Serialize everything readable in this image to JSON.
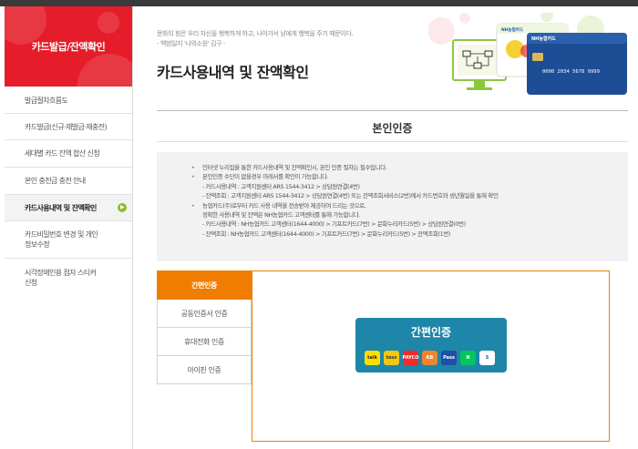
{
  "sidebar": {
    "title": "카드발급/잔액확인",
    "items": [
      {
        "label": "발급절차흐름도"
      },
      {
        "label": "카드발급(신규·재발급·재충전)"
      },
      {
        "label": "세대별 카드 잔액 합산 신청"
      },
      {
        "label": "본인 충전금 충전 안내"
      },
      {
        "label": "카드사용내역 및 잔액확인"
      },
      {
        "label": "카드비밀번호 변경 및 개인",
        "label2": "정보수정"
      },
      {
        "label": "시각장애인용 점자 스티커",
        "label2": "신청"
      }
    ]
  },
  "header": {
    "quote1": "문화의 힘은 우리 자신을 행복하게 하고, 나아가서 남에게 행복을 주기 때문이다.",
    "quote2": "- 백범일지 '나의소원' 김구 -",
    "title": "카드사용내역 및 잔액확인",
    "card_brand": "NH농협카드",
    "card_number": "0000  2034  5678  9999"
  },
  "section": {
    "title": "본인인증"
  },
  "notice": {
    "lines": [
      "인터넷 누리집을 통한 카드사용내역 및 잔액확인시, 본인 인증 절차는 필수입니다.",
      "본인인증 수단이 없을경우 아래서를 확인이 가능합니다.",
      "- 카드사용내역 : 고객지원센터 ARS 1544-3412 > 상담원연결(4번)",
      "- 잔액조회 : 고객지원센터 ARS 1544-3412 > 상담원연결(4번) 또는 잔액조회서비스(2번)에서 카드번호와 생년월일을 통해 확인",
      "농협카드(주)로부터 카드 사용 내역을 전송받아 제공하여 드리는 것으로,",
      "정확한 사용내역 및 잔액은 NH농협카드 고객센터를 통해 가능합니다.",
      "- 카드사용내역 : NH농협카드 고객센터(1644-4000) > 기프트카드(7번) > 문화누리카드(5번) > 상담원연결(0번)",
      "- 잔액조회 : NH농협카드 고객센터(1644-4000) > 기프트카드(7번) > 문화누리카드(5번) > 잔액조회(1번)"
    ]
  },
  "tabs": [
    {
      "label": "간편인증"
    },
    {
      "label": "공동인증서 인증"
    },
    {
      "label": "휴대전화 인증"
    },
    {
      "label": "아이핀 인증"
    }
  ],
  "auth": {
    "title": "간편인증",
    "providers": [
      {
        "name": "kakao-icon",
        "text": "talk",
        "color": "#f9e000",
        "fg": "#3a1d1d"
      },
      {
        "name": "toss-icon",
        "text": "toss",
        "color": "#f2c811",
        "fg": "#333"
      },
      {
        "name": "payco-icon",
        "text": "PAYCO",
        "color": "#ef2b2b",
        "fg": "#fff"
      },
      {
        "name": "kb-icon",
        "text": "KB",
        "color": "#f0852d",
        "fg": "#fff"
      },
      {
        "name": "pass-icon",
        "text": "Pass",
        "color": "#1f4fa8",
        "fg": "#fff"
      },
      {
        "name": "naver-icon",
        "text": "N",
        "color": "#03c75a",
        "fg": "#fff"
      },
      {
        "name": "shinhan-icon",
        "text": "S",
        "color": "#ffffff",
        "fg": "#1f5fbf"
      }
    ]
  }
}
